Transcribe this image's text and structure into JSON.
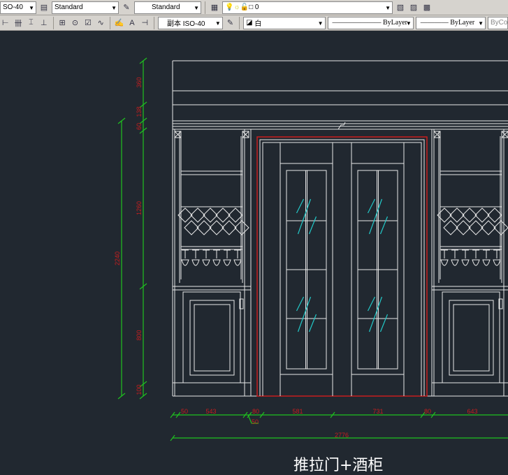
{
  "toolbar1": {
    "dimstyle": "SO-40",
    "textstyle": "Standard",
    "tablestyle": "Standard",
    "layer": "0"
  },
  "toolbar2": {
    "dimstyle": "副本 ISO-40",
    "color": "白",
    "linetype": "ByLayer",
    "lineweight": "ByLayer",
    "plotstyle": "ByCo"
  },
  "drawing": {
    "title": "推拉门+酒柜",
    "vertical_dims": [
      "360",
      "138",
      "60",
      "1260",
      "800",
      "100"
    ],
    "overall_height": "2240",
    "horizontal_dims": [
      "50",
      "543",
      "80",
      "581",
      "731",
      "80",
      "643"
    ],
    "leader_dim": "50",
    "overall_width": "2776",
    "colors": {
      "background": "#212830",
      "lines": "#e8e8e8",
      "dimension": "#1fc21f",
      "dim_text": "#c81e1e",
      "glass": "#22c8c8",
      "door_frame": "#c81e1e"
    }
  }
}
